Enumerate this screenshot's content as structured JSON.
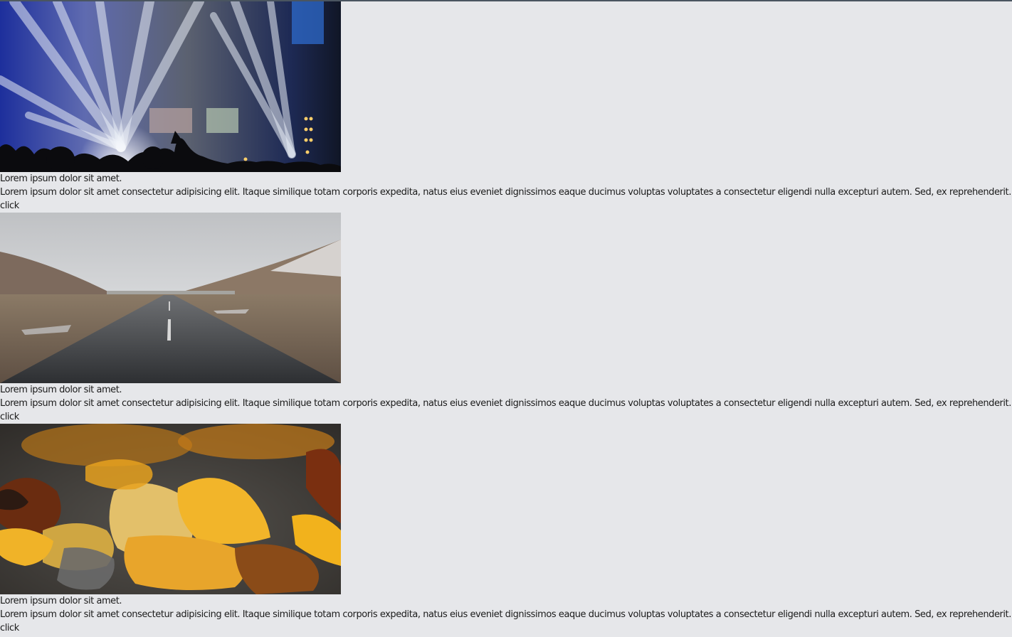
{
  "cards": [
    {
      "image": "concert-stage-lights",
      "title": "Lorem ipsum dolor sit amet.",
      "text": "Lorem ipsum dolor sit amet consectetur adipisicing elit. Itaque similique totam corporis expedita, natus eius eveniet dignissimos eaque ducimus voluptas voluptates a consectetur eligendi nulla excepturi autem. Sed, ex reprehenderit.",
      "link": "click"
    },
    {
      "image": "mountain-road",
      "title": "Lorem ipsum dolor sit amet.",
      "text": "Lorem ipsum dolor sit amet consectetur adipisicing elit. Itaque similique totam corporis expedita, natus eius eveniet dignissimos eaque ducimus voluptas voluptates a consectetur eligendi nulla excepturi autem. Sed, ex reprehenderit.",
      "link": "click"
    },
    {
      "image": "autumn-leaves",
      "title": "Lorem ipsum dolor sit amet.",
      "text": "Lorem ipsum dolor sit amet consectetur adipisicing elit. Itaque similique totam corporis expedita, natus eius eveniet dignissimos eaque ducimus voluptas voluptates a consectetur eligendi nulla excepturi autem. Sed, ex reprehenderit.",
      "link": "click"
    }
  ]
}
